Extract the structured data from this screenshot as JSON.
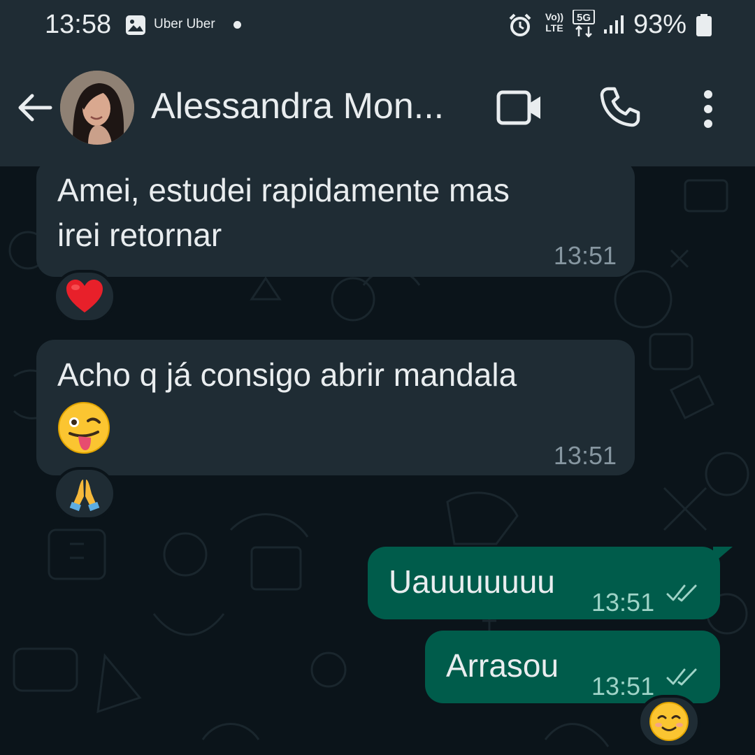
{
  "status_bar": {
    "time": "13:58",
    "notification_text": "Uber Uber",
    "network_volte": "Vo)) LTE",
    "network_5g": "5G",
    "battery": "93%",
    "icons": [
      "gallery-icon",
      "alarm-icon",
      "volte-icon",
      "5g-icon",
      "signal-icon",
      "battery-icon"
    ]
  },
  "header": {
    "contact_name": "Alessandra Mon...",
    "icons": [
      "back-arrow-icon",
      "video-camera-icon",
      "phone-icon",
      "more-vertical-icon"
    ]
  },
  "messages": [
    {
      "direction": "incoming",
      "lines": [
        "Amei, estudei rapidamente mas",
        "irei retornar"
      ],
      "time": "13:51",
      "reaction": "red-heart"
    },
    {
      "direction": "incoming",
      "lines": [
        "Acho q já consigo abrir mandala"
      ],
      "emoji": "winking-face-with-tongue",
      "time": "13:51",
      "reaction": "folded-hands"
    },
    {
      "direction": "outgoing",
      "lines": [
        "Uauuuuuuu"
      ],
      "time": "13:51",
      "status": "read"
    },
    {
      "direction": "outgoing",
      "lines": [
        "Arrasou"
      ],
      "time": "13:51",
      "status": "read",
      "reaction": "smiling-face"
    }
  ],
  "colors": {
    "background": "#0b141a",
    "header": "#1f2c34",
    "incoming_bubble": "#1f2c34",
    "outgoing_bubble": "#005c4b",
    "text": "#e9edef",
    "time_text": "#8696a0"
  }
}
